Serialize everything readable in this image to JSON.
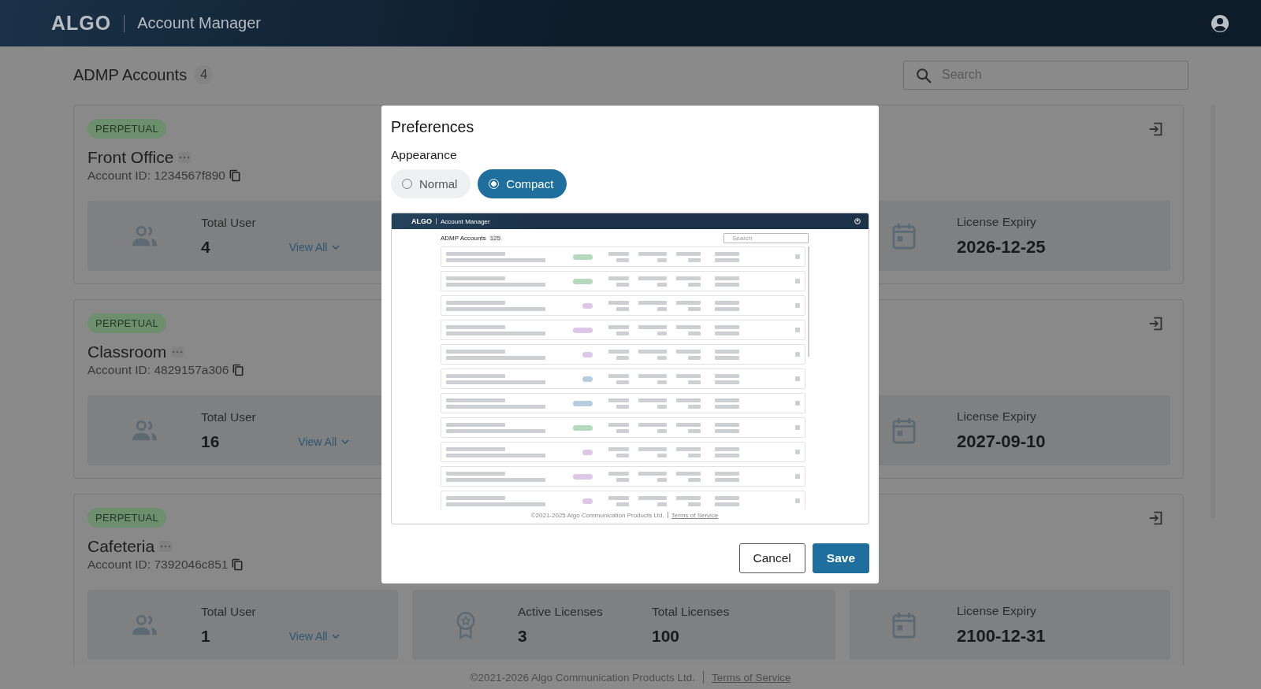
{
  "header": {
    "logo": "ALGO",
    "title": "Account Manager"
  },
  "page": {
    "title": "ADMP Accounts",
    "count": "4",
    "search": {
      "placeholder": "Search"
    }
  },
  "accounts": [
    {
      "license_type": "PERPETUAL",
      "name": "Front Office",
      "account_id": "Account ID: 1234567f890",
      "users_label": "Total User",
      "users": "4",
      "view_all": "View All",
      "expiry_label": "License Expiry",
      "expiry": "2026-12-25"
    },
    {
      "license_type": "PERPETUAL",
      "name": "Classroom",
      "account_id": "Account ID: 4829157a306",
      "users_label": "Total User",
      "users": "16",
      "view_all": "View All",
      "expiry_label": "License Expiry",
      "expiry": "2027-09-10"
    },
    {
      "license_type": "PERPETUAL",
      "name": "Cafeteria",
      "account_id": "Account ID: 7392046c851",
      "users_label": "Total User",
      "users": "1",
      "view_all": "View All",
      "licenses": {
        "active_label": "Active Licenses",
        "active": "3",
        "total_label": "Total Licenses",
        "total": "100"
      },
      "expiry_label": "License Expiry",
      "expiry": "2100-12-31"
    }
  ],
  "footer": {
    "copyright": "©2021-2026 Algo Communication Products Ltd.",
    "link": "Terms of Service"
  },
  "dialog": {
    "title": "Preferences",
    "section": "Appearance",
    "options": [
      {
        "label": "Normal",
        "selected": false
      },
      {
        "label": "Compact",
        "selected": true
      }
    ],
    "preview": {
      "logo": "ALGO",
      "title": "Account Manager",
      "heading": "ADMP Accounts",
      "count": "125",
      "search_placeholder": "Search",
      "rows": [
        {
          "color": "#b5d9bd"
        },
        {
          "color": "#b5d9bd"
        },
        {
          "color": "#dcc8e6"
        },
        {
          "color": "#dcc8e6"
        },
        {
          "color": "#dcc8e6"
        },
        {
          "color": "#b6cde0"
        },
        {
          "color": "#b6cde0"
        },
        {
          "color": "#b5d9bd"
        },
        {
          "color": "#dcc8e6"
        },
        {
          "color": "#dcc8e6"
        },
        {
          "color": "#dcc8e6"
        }
      ],
      "copyright": "©2021-2025 Algo Communication Products Ltd.",
      "link": "Terms of Service"
    },
    "buttons": [
      {
        "label": "Cancel",
        "kind": "secondary"
      },
      {
        "label": "Save",
        "kind": "primary"
      }
    ]
  }
}
